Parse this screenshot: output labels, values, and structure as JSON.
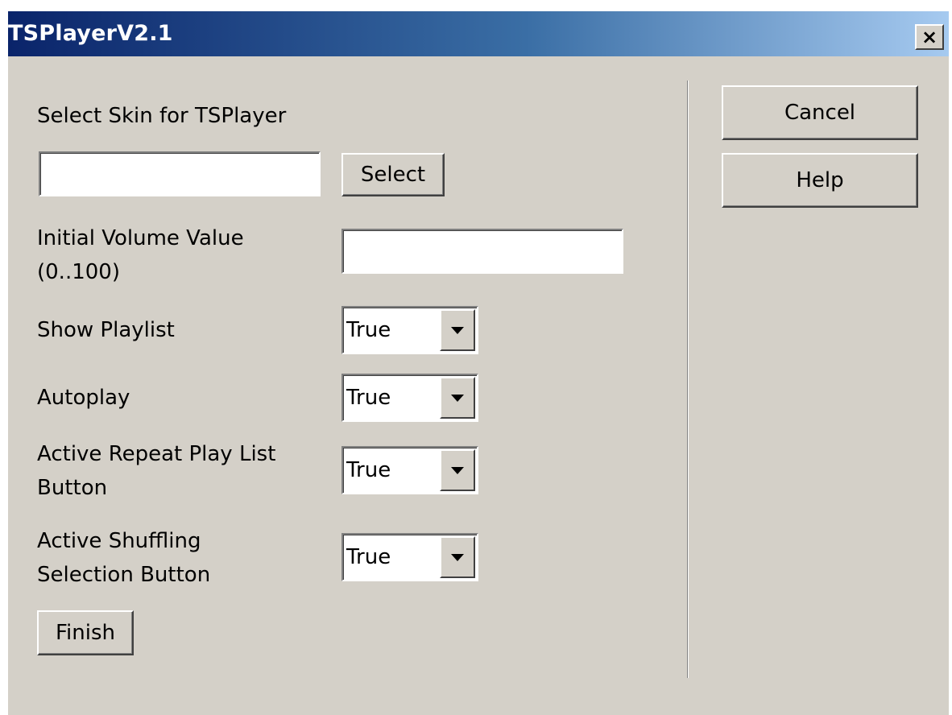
{
  "window": {
    "title": "TSPlayerV2.1",
    "close_label": "×"
  },
  "skin": {
    "label": "Select Skin for TSPlayer",
    "value": "",
    "select_button": "Select"
  },
  "volume": {
    "label_line1": "Initial Volume Value",
    "label_line2": "(0..100)",
    "value": ""
  },
  "show_playlist": {
    "label": "Show Playlist",
    "value": "True"
  },
  "autoplay": {
    "label": "Autoplay",
    "value": "True"
  },
  "repeat_playlist": {
    "label_line1": "Active Repeat Play List",
    "label_line2": "Button",
    "value": "True"
  },
  "shuffle": {
    "label_line1": "Active Shuffling",
    "label_line2": "Selection Button",
    "value": "True"
  },
  "buttons": {
    "finish": "Finish",
    "cancel": "Cancel",
    "help": "Help"
  },
  "colors": {
    "dialog_background": "#d4d0c8",
    "titlebar_start": "#0a246a",
    "titlebar_end": "#a6caf0",
    "title_text": "#ffffff"
  },
  "icons": {
    "close": "close-icon",
    "dropdown": "chevron-down-icon"
  }
}
